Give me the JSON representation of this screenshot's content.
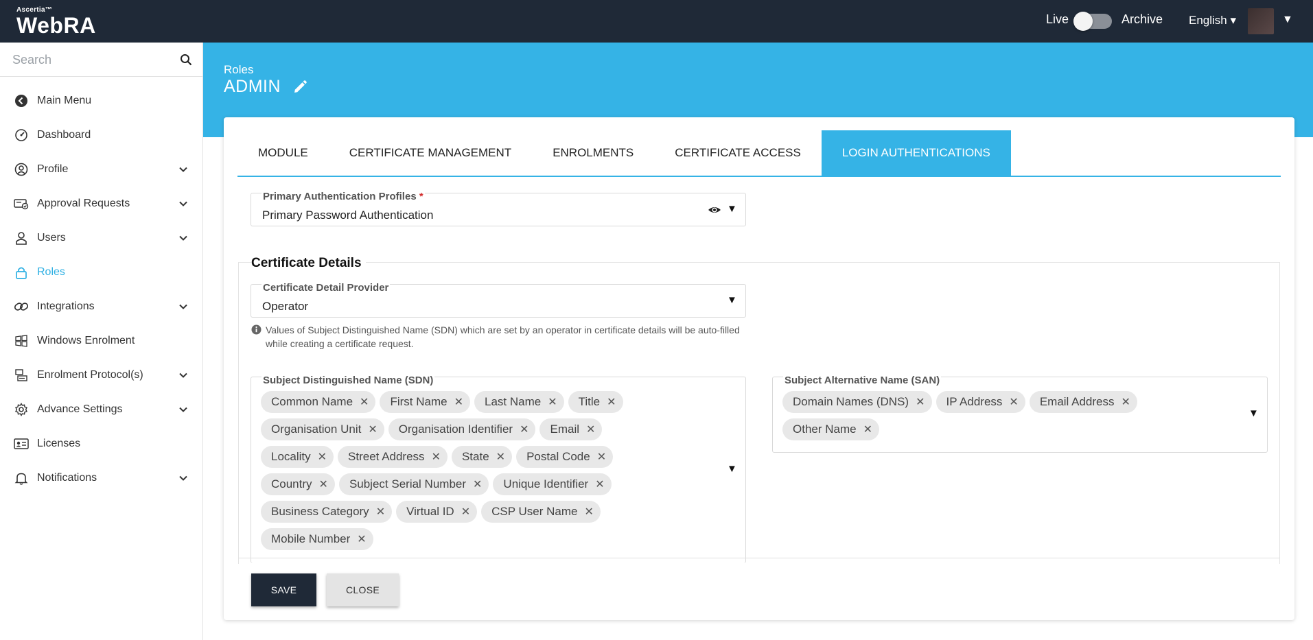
{
  "topbar": {
    "brand_small": "Ascertia™",
    "brand_name": "WebRA",
    "live_label": "Live",
    "archive_label": "Archive",
    "language": "English ▾",
    "user_caret": "▼"
  },
  "sidebar": {
    "search_placeholder": "Search",
    "items": [
      {
        "label": "Main Menu",
        "icon": "back-arrow-icon",
        "chevron": false
      },
      {
        "label": "Dashboard",
        "icon": "dashboard-icon",
        "chevron": false
      },
      {
        "label": "Profile",
        "icon": "profile-icon",
        "chevron": true
      },
      {
        "label": "Approval Requests",
        "icon": "approval-icon",
        "chevron": true
      },
      {
        "label": "Users",
        "icon": "users-icon",
        "chevron": true
      },
      {
        "label": "Roles",
        "icon": "lock-icon",
        "chevron": false,
        "active": true
      },
      {
        "label": "Integrations",
        "icon": "link-icon",
        "chevron": true
      },
      {
        "label": "Windows Enrolment",
        "icon": "windows-icon",
        "chevron": false
      },
      {
        "label": "Enrolment Protocol(s)",
        "icon": "protocol-icon",
        "chevron": true
      },
      {
        "label": "Advance Settings",
        "icon": "gear-icon",
        "chevron": true
      },
      {
        "label": "Licenses",
        "icon": "license-icon",
        "chevron": false
      },
      {
        "label": "Notifications",
        "icon": "bell-icon",
        "chevron": true
      }
    ]
  },
  "header": {
    "breadcrumb": "Roles",
    "title": "ADMIN"
  },
  "tabs": [
    {
      "label": "MODULE"
    },
    {
      "label": "CERTIFICATE MANAGEMENT"
    },
    {
      "label": "ENROLMENTS"
    },
    {
      "label": "CERTIFICATE ACCESS"
    },
    {
      "label": "LOGIN AUTHENTICATIONS",
      "active": true
    }
  ],
  "primary_auth": {
    "label": "Primary Authentication Profiles",
    "required_mark": "*",
    "value": "Primary Password Authentication"
  },
  "certificate_details": {
    "title": "Certificate Details",
    "provider_label": "Certificate Detail Provider",
    "provider_value": "Operator",
    "info_text": "Values of Subject Distinguished Name (SDN) which are set by an operator in certificate details will be auto-filled while creating a certificate request.",
    "sdn_label": "Subject Distinguished Name (SDN)",
    "sdn_chips": [
      "Common Name",
      "First Name",
      "Last Name",
      "Title",
      "Organisation Unit",
      "Organisation Identifier",
      "Email",
      "Locality",
      "Street Address",
      "State",
      "Postal Code",
      "Country",
      "Subject Serial Number",
      "Unique Identifier",
      "Business Category",
      "Virtual ID",
      "CSP User Name",
      "Mobile Number"
    ],
    "san_label": "Subject Alternative Name (SAN)",
    "san_chips": [
      "Domain Names (DNS)",
      "IP Address",
      "Email Address",
      "Other Name"
    ]
  },
  "buttons": {
    "save": "SAVE",
    "close": "CLOSE"
  },
  "colors": {
    "topbar": "#1f2937",
    "accent": "#35b3e6",
    "active_nav": "#2fb0e3"
  }
}
